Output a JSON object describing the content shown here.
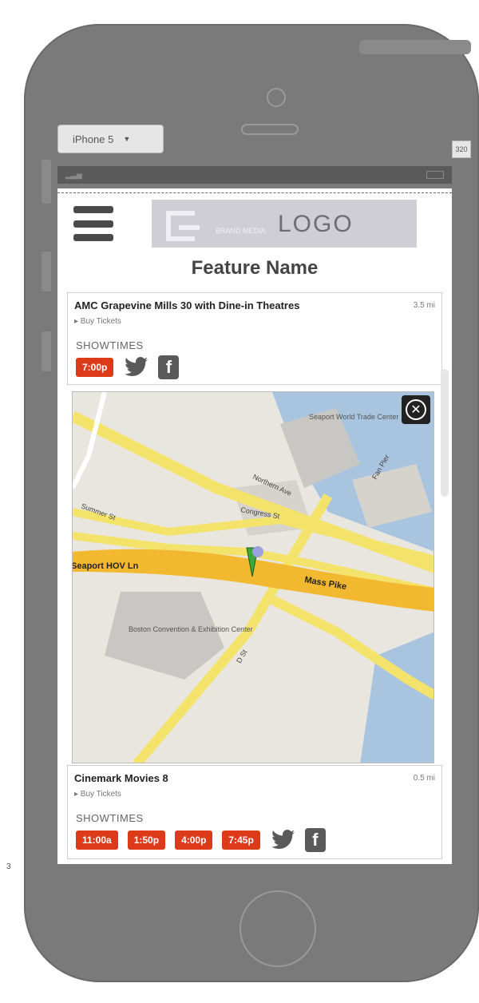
{
  "device": {
    "name": "iPhone 5",
    "width_label": "320",
    "side_label": "3"
  },
  "header": {
    "logo_text": "LOGO",
    "logo_subtext": "BRAND MEDIA",
    "feature_name": "Feature Name"
  },
  "theaters": [
    {
      "name": "AMC Grapevine Mills 30 with Dine-in Theatres",
      "distance": "3.5 mi",
      "buy_label": "▸ Buy Tickets",
      "showtimes_label": "SHOWTIMES",
      "times": [
        "7:00p"
      ]
    },
    {
      "name": "Cinemark Movies 8",
      "distance": "0.5 mi",
      "buy_label": "▸ Buy Tickets",
      "showtimes_label": "SHOWTIMES",
      "times": [
        "11:00a",
        "1:50p",
        "4:00p",
        "7:45p"
      ]
    }
  ],
  "map": {
    "labels": {
      "northern_ave": "Northern Ave",
      "seaport_center": "Seaport World Trade Center",
      "congress": "Congress St",
      "summer": "Summer St",
      "seaport_hov": "Seaport HOV Ln",
      "mass_pike": "Mass Pike",
      "convention": "Boston Convention & Exhibition Center",
      "d_st": "D St",
      "fan_pier": "Fan Pier"
    }
  },
  "colors": {
    "accent": "#dd3a1a",
    "road": "#f4e36a",
    "highway": "#f2b830",
    "water": "#a9c4df"
  },
  "icons": [
    "menu-icon",
    "twitter-icon",
    "facebook-icon",
    "close-icon",
    "map-pin-icon"
  ]
}
